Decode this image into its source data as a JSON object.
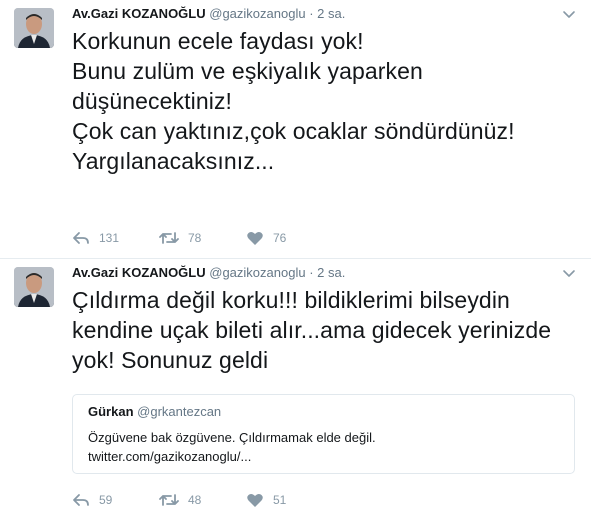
{
  "tweets": [
    {
      "author_name": "Av.Gazi KOZANOĞLU",
      "author_handle": "@gazikozanoglu",
      "separator": "·",
      "time": "2 sa.",
      "text": "Korkunun ecele faydası yok!\nBunu zulüm ve eşkiyalık yaparken düşünecektiniz!\nÇok can yaktınız,çok ocaklar söndürdünüz!\nYargılanacaksınız...",
      "replies": "131",
      "retweets": "78",
      "likes": "76"
    },
    {
      "author_name": "Av.Gazi KOZANOĞLU",
      "author_handle": "@gazikozanoglu",
      "separator": "·",
      "time": "2 sa.",
      "text": "Çıldırma değil korku!!! bildiklerimi bilseydin kendine uçak bileti alır...ama gidecek yerinizde yok! Sonunuz geldi",
      "quoted": {
        "author_name": "Gürkan",
        "author_handle": "@grkantezcan",
        "text": "Özgüvene bak özgüvene. Çıldırmamak elde değil.\ntwitter.com/gazikozanoglu/..."
      },
      "replies": "59",
      "retweets": "48",
      "likes": "51"
    }
  ],
  "icons": {
    "menu": "chevron-down-icon",
    "reply": "reply-icon",
    "retweet": "retweet-icon",
    "like": "heart-icon"
  },
  "colors": {
    "text": "#14171a",
    "muted": "#657786",
    "icon": "#8899a6",
    "border": "#e6ecf0"
  }
}
